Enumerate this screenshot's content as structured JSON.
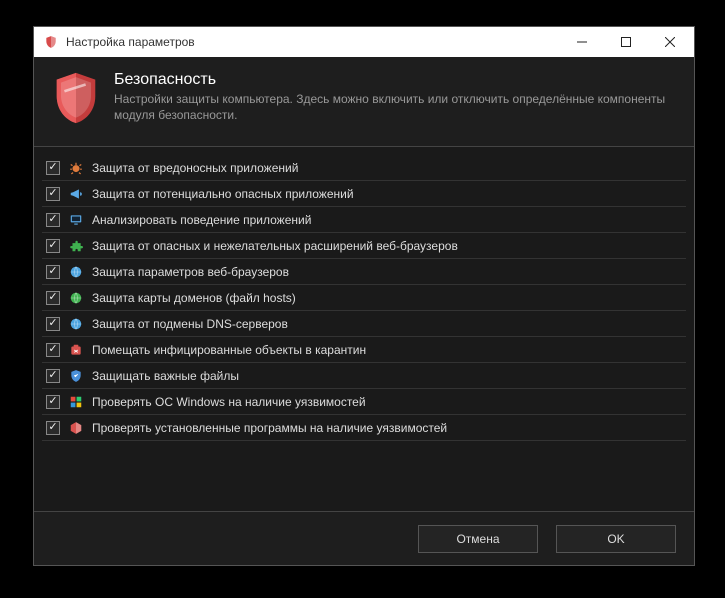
{
  "window": {
    "title": "Настройка параметров"
  },
  "header": {
    "title": "Безопасность",
    "description": "Настройки защиты компьютера. Здесь можно включить или отключить определённые компоненты модуля безопасности."
  },
  "options": [
    {
      "checked": true,
      "icon": "bug-icon",
      "color": "#e07b3c",
      "label": "Защита от вредоносных приложений"
    },
    {
      "checked": true,
      "icon": "megaphone-icon",
      "color": "#5aa9e6",
      "label": "Защита от потенциально опасных приложений"
    },
    {
      "checked": true,
      "icon": "monitor-icon",
      "color": "#5aa9e6",
      "label": "Анализировать поведение приложений"
    },
    {
      "checked": true,
      "icon": "puzzle-icon",
      "color": "#3fb14f",
      "label": "Защита от опасных и нежелательных расширений веб-браузеров"
    },
    {
      "checked": true,
      "icon": "globe-gear-icon",
      "color": "#4aa3df",
      "label": "Защита параметров веб-браузеров"
    },
    {
      "checked": true,
      "icon": "globe-icon",
      "color": "#3fb14f",
      "label": "Защита карты доменов (файл hosts)"
    },
    {
      "checked": true,
      "icon": "dns-icon",
      "color": "#4aa3df",
      "label": "Защита от подмены DNS-серверов"
    },
    {
      "checked": true,
      "icon": "quarantine-icon",
      "color": "#d9534f",
      "label": "Помещать инфицированные объекты в карантин"
    },
    {
      "checked": true,
      "icon": "shield-file-icon",
      "color": "#4a90d9",
      "label": "Защищать важные файлы"
    },
    {
      "checked": true,
      "icon": "windows-icon",
      "color": "#e0a03c",
      "label": "Проверять ОС Windows на наличие уязвимостей"
    },
    {
      "checked": true,
      "icon": "package-icon",
      "color": "#d9534f",
      "label": "Проверять установленные программы на наличие уязвимостей"
    }
  ],
  "footer": {
    "cancel": "Отмена",
    "ok": "OK"
  }
}
